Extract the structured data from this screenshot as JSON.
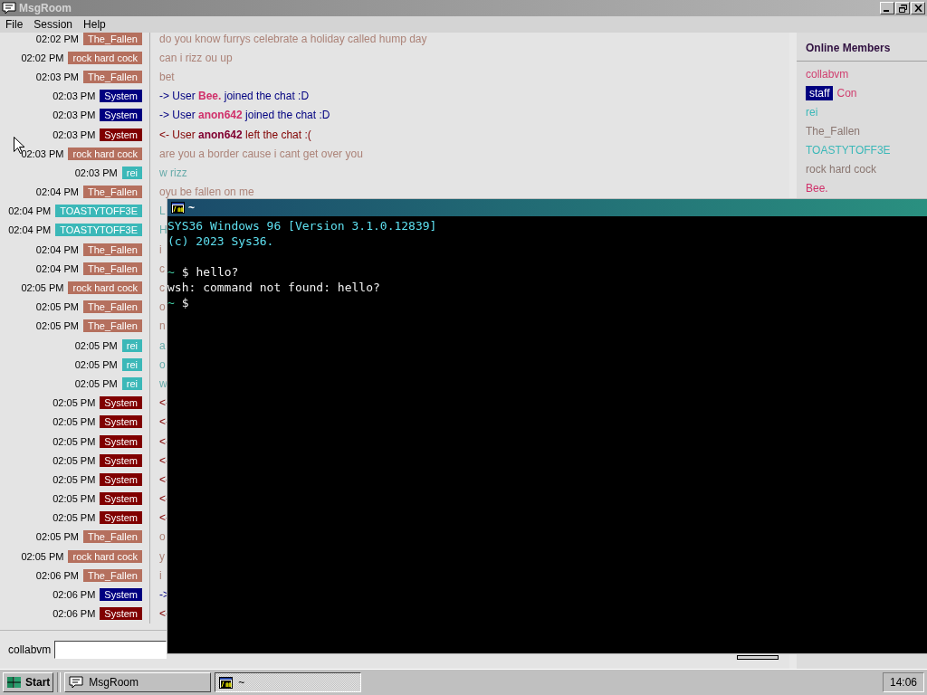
{
  "window": {
    "title": "MsgRoom"
  },
  "menu": [
    "File",
    "Session",
    "Help"
  ],
  "messages": [
    {
      "time": "02:02 PM",
      "sender": "The_Fallen",
      "color": "#b5705e",
      "text": "do you know furrys celebrate a holiday called hump day"
    },
    {
      "time": "02:02 PM",
      "sender": "rock hard cock",
      "color": "#b5705e",
      "text": "can i rizz ou up"
    },
    {
      "time": "02:03 PM",
      "sender": "The_Fallen",
      "color": "#b5705e",
      "text": "bet"
    },
    {
      "time": "02:03 PM",
      "sender": "System",
      "color": "#000080",
      "text": "-> User",
      "user": "Bee.",
      "suffix": "joined the chat :D"
    },
    {
      "time": "02:03 PM",
      "sender": "System",
      "color": "#000080",
      "text": "-> User",
      "user": "anon642",
      "suffix": "joined the chat :D"
    },
    {
      "time": "02:03 PM",
      "sender": "System",
      "color": "#800000",
      "text": "<- User",
      "user": "anon642",
      "suffix": "left the chat :("
    },
    {
      "time": "02:03 PM",
      "sender": "rock hard cock",
      "color": "#b5705e",
      "text": "are you a border cause i cant get over you"
    },
    {
      "time": "02:03 PM",
      "sender": "rei",
      "color": "#3bb8b8",
      "text": "w rizz"
    },
    {
      "time": "02:04 PM",
      "sender": "The_Fallen",
      "color": "#b5705e",
      "text": "oyu be fallen on me"
    },
    {
      "time": "02:04 PM",
      "sender": "TOASTYTOFF3E",
      "color": "#3bb8b8",
      "text": "L"
    },
    {
      "time": "02:04 PM",
      "sender": "TOASTYTOFF3E",
      "color": "#3bb8b8",
      "text": "H"
    },
    {
      "time": "02:04 PM",
      "sender": "The_Fallen",
      "color": "#b5705e",
      "text": "i"
    },
    {
      "time": "02:04 PM",
      "sender": "The_Fallen",
      "color": "#b5705e",
      "text": "c"
    },
    {
      "time": "02:05 PM",
      "sender": "rock hard cock",
      "color": "#b5705e",
      "text": "c"
    },
    {
      "time": "02:05 PM",
      "sender": "The_Fallen",
      "color": "#b5705e",
      "text": "o"
    },
    {
      "time": "02:05 PM",
      "sender": "The_Fallen",
      "color": "#b5705e",
      "text": "n"
    },
    {
      "time": "02:05 PM",
      "sender": "rei",
      "color": "#3bb8b8",
      "text": "a"
    },
    {
      "time": "02:05 PM",
      "sender": "rei",
      "color": "#3bb8b8",
      "text": "o"
    },
    {
      "time": "02:05 PM",
      "sender": "rei",
      "color": "#3bb8b8",
      "text": "w"
    },
    {
      "time": "02:05 PM",
      "sender": "System",
      "color": "#800000",
      "text": "<-"
    },
    {
      "time": "02:05 PM",
      "sender": "System",
      "color": "#800000",
      "text": "<-"
    },
    {
      "time": "02:05 PM",
      "sender": "System",
      "color": "#800000",
      "text": "<-"
    },
    {
      "time": "02:05 PM",
      "sender": "System",
      "color": "#800000",
      "text": "<-"
    },
    {
      "time": "02:05 PM",
      "sender": "System",
      "color": "#800000",
      "text": "<-"
    },
    {
      "time": "02:05 PM",
      "sender": "System",
      "color": "#800000",
      "text": "<-"
    },
    {
      "time": "02:05 PM",
      "sender": "System",
      "color": "#800000",
      "text": "<-"
    },
    {
      "time": "02:05 PM",
      "sender": "The_Fallen",
      "color": "#b5705e",
      "text": "o"
    },
    {
      "time": "02:05 PM",
      "sender": "rock hard cock",
      "color": "#b5705e",
      "text": "y"
    },
    {
      "time": "02:06 PM",
      "sender": "The_Fallen",
      "color": "#b5705e",
      "text": "i"
    },
    {
      "time": "02:06 PM",
      "sender": "System",
      "color": "#000080",
      "text": "->"
    },
    {
      "time": "02:06 PM",
      "sender": "System",
      "color": "#800000",
      "text": "<-"
    }
  ],
  "composer": {
    "nickname": "collabvm"
  },
  "members": {
    "title": "Online Members",
    "items": [
      {
        "name": "collabvm",
        "color": "#d04070"
      },
      {
        "badge": "staff",
        "name": "Con",
        "color": "#d04070"
      },
      {
        "name": "rei",
        "color": "#3bb8b8"
      },
      {
        "name": "The_Fallen",
        "color": "#8a7670"
      },
      {
        "name": "TOASTYTOFF3E",
        "color": "#3bb8b8"
      },
      {
        "name": "rock hard cock",
        "color": "#8a7670"
      },
      {
        "name": "Bee.",
        "color": "#d0306a"
      }
    ]
  },
  "terminal": {
    "title": "~",
    "lines": [
      {
        "kind": "banner",
        "text": "SYS36 Windows 96 [Version 3.1.0.12839]"
      },
      {
        "kind": "banner",
        "text": "(c) 2023 Sys36."
      },
      {
        "kind": "blank"
      },
      {
        "kind": "prompt",
        "cwd": "~",
        "symbol": "$",
        "command": "hello?"
      },
      {
        "kind": "output",
        "text": "wsh: command not found: hello?"
      },
      {
        "kind": "prompt",
        "cwd": "~",
        "symbol": "$"
      }
    ]
  },
  "taskbar": {
    "start": "Start",
    "tasks": [
      {
        "label": "MsgRoom",
        "kind": "chat",
        "selected": false
      },
      {
        "label": "~",
        "kind": "terminal",
        "selected": true
      }
    ],
    "clock": "14:06"
  }
}
